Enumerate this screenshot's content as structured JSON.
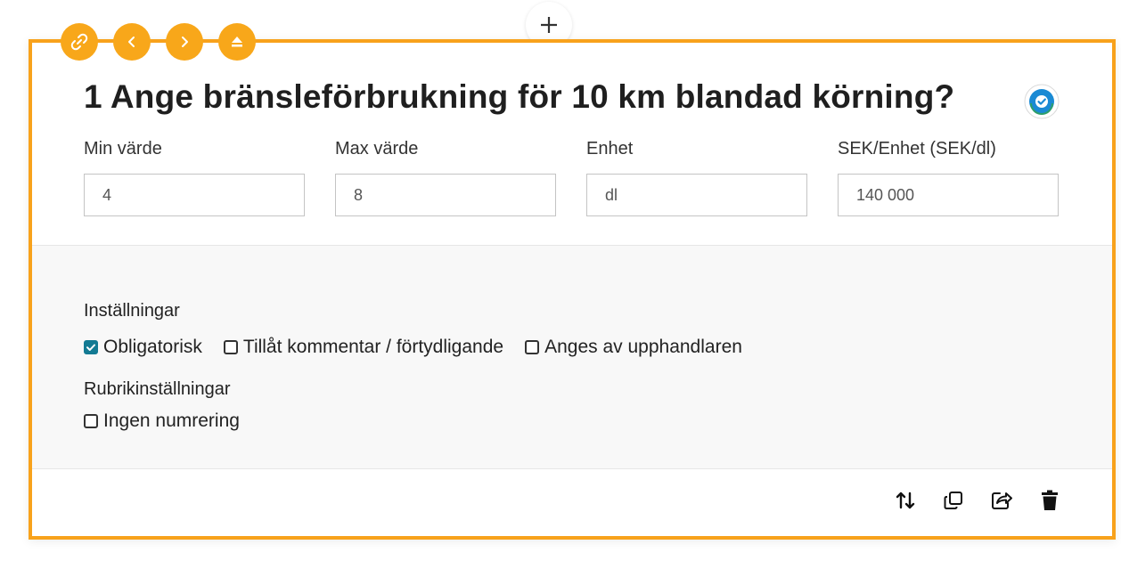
{
  "add_button": {
    "icon": "plus-icon"
  },
  "toolbar": {
    "buttons": [
      {
        "icon": "link-icon"
      },
      {
        "icon": "chevron-left-icon"
      },
      {
        "icon": "chevron-right-icon"
      },
      {
        "icon": "eject-icon"
      }
    ],
    "color": "#f8a71a"
  },
  "question": {
    "title": "1 Ange bränsleförbrukning för 10 km blandad körning?",
    "status_icon": "verified-check-icon"
  },
  "fields": [
    {
      "label": "Min värde",
      "value": "4"
    },
    {
      "label": "Max värde",
      "value": "8"
    },
    {
      "label": "Enhet",
      "value": "dl"
    },
    {
      "label": "SEK/Enhet (SEK/dl)",
      "value": "140 000"
    }
  ],
  "settings": {
    "title": "Inställningar",
    "options": [
      {
        "label": "Obligatorisk",
        "checked": true
      },
      {
        "label": "Tillåt kommentar / förtydligande",
        "checked": false
      },
      {
        "label": "Anges av upphandlaren",
        "checked": false
      }
    ]
  },
  "heading_settings": {
    "title": "Rubrikinställningar",
    "options": [
      {
        "label": "Ingen numrering",
        "checked": false
      }
    ]
  },
  "actions": [
    "sort-icon",
    "copy-icon",
    "share-icon",
    "trash-icon"
  ],
  "colors": {
    "accent": "#f8a21c",
    "checkbox": "#137a93"
  }
}
